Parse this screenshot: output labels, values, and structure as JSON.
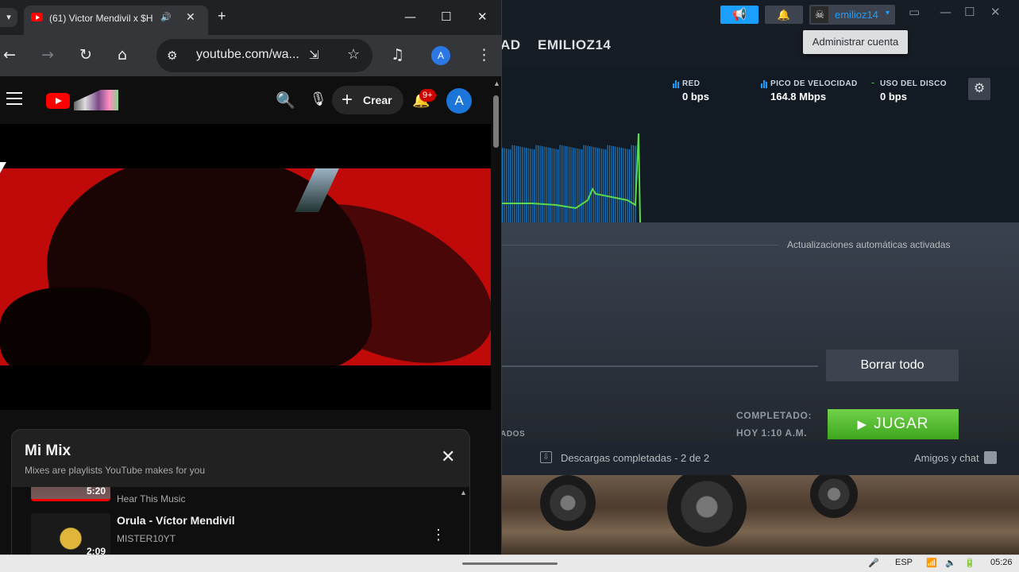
{
  "steam": {
    "nav": {
      "partial_item": "AD",
      "profile_item": "EMILIOZ14"
    },
    "account": {
      "name": "emilioz14",
      "tooltip": "Administrar cuenta"
    },
    "stats": {
      "network_label": "RED",
      "network_value": "0 bps",
      "peak_label": "PICO DE VELOCIDAD",
      "peak_value": "164.8 Mbps",
      "disk_label": "USO DEL DISCO",
      "disk_value": "0 bps"
    },
    "colors": {
      "network": "#1a9fff",
      "disk": "#5cdb4a",
      "accent": "#1a9fff",
      "play": "#5cbf2a"
    },
    "auto_updates": "Actualizaciones automáticas activadas",
    "clear_button": "Borrar todo",
    "completed_label": "COMPLETADO:",
    "completed_time": "HOY 1:10 A.M.",
    "partial_label": "ADOS",
    "play_button": "JUGAR",
    "footer": {
      "downloads": "Descargas completadas - 2 de 2",
      "friends": "Amigos y chat"
    }
  },
  "chrome": {
    "tab": {
      "title": "(61) Victor Mendivil x $H"
    },
    "url": "youtube.com/wa...",
    "profile_initial": "A"
  },
  "youtube": {
    "create_label": "Crear",
    "notifications_badge": "9+",
    "avatar_initial": "A",
    "mix": {
      "title": "Mi Mix",
      "subtitle": "Mixes are playlists YouTube makes for you",
      "items": [
        {
          "title": "",
          "channel": "Hear This Music",
          "duration": "5:20"
        },
        {
          "title": "Orula - Víctor Mendivil",
          "channel": "MISTER10YT",
          "duration": "2:09"
        }
      ]
    }
  },
  "taskbar": {
    "language": "ESP",
    "time": "05:26"
  },
  "icons": {
    "steam": [
      "megaphone-icon",
      "bell-icon",
      "gear-icon",
      "downloads-icon",
      "friends-icon"
    ],
    "chrome": [
      "back-icon",
      "forward-icon",
      "reload-icon",
      "home-icon",
      "site-info-icon",
      "install-icon",
      "star-icon",
      "media-control-icon",
      "menu-icon"
    ],
    "youtube": [
      "menu-icon",
      "search-icon",
      "mic-icon",
      "bell-icon",
      "close-icon",
      "more-icon"
    ]
  }
}
